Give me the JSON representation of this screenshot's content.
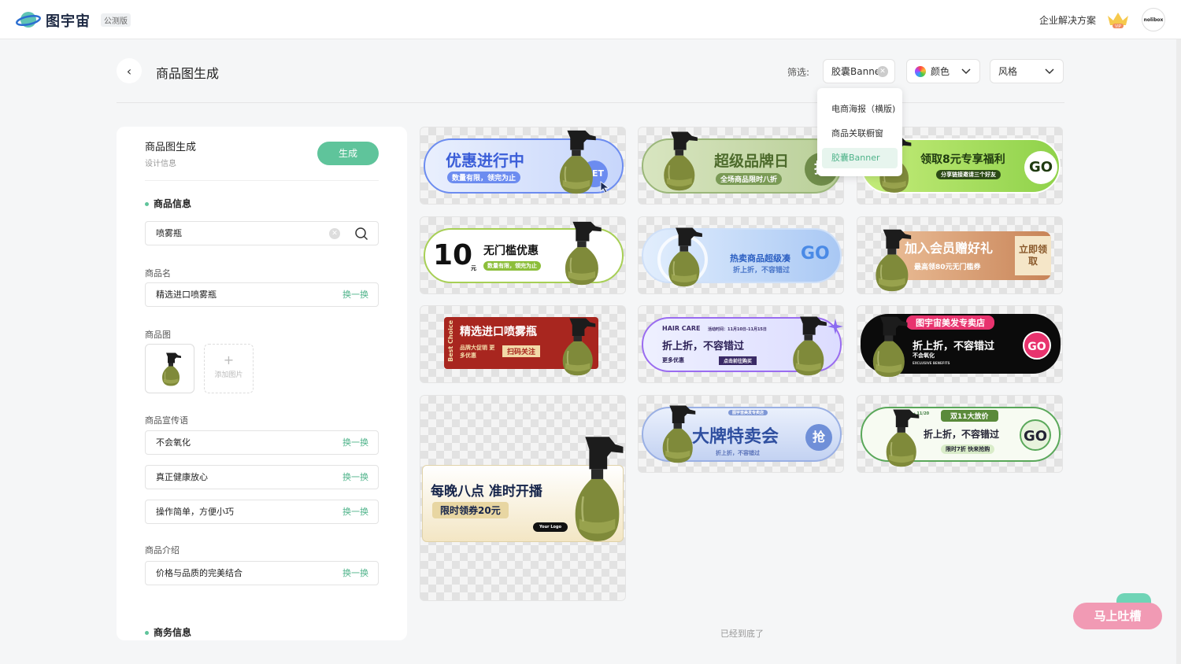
{
  "app": {
    "name": "图宇宙",
    "badge": "公测版",
    "enterprise_link": "企业解决方案",
    "vip_label": "VIP",
    "avatar_text": "nolibox"
  },
  "page": {
    "title": "商品图生成",
    "end_text": "已经到底了",
    "feedback": "马上吐槽"
  },
  "filters": {
    "label": "筛选:",
    "selected": "胶囊Banner",
    "color": "颜色",
    "style": "风格",
    "options": [
      "电商海报（横版)",
      "商品关联橱窗",
      "胶囊Banner"
    ]
  },
  "panel": {
    "title": "商品图生成",
    "subtitle": "设计信息",
    "generate": "生成",
    "sections": {
      "product_info": "商品信息",
      "business_info": "商务信息"
    },
    "search_value": "喷雾瓶",
    "swap_label": "换一换",
    "name_label": "商品名",
    "name_value": "精选进口喷雾瓶",
    "image_label": "商品图",
    "add_image": "添加图片",
    "slogan_label": "商品宣传语",
    "slogans": [
      "不会氧化",
      "真正健康放心",
      "操作简单，方便小巧"
    ],
    "intro_label": "商品介绍",
    "intro_value": "价格与品质的完美结合"
  },
  "colors": {
    "accent": "#5fc49b",
    "accent_text": "#4fb38a"
  },
  "cards": [
    {
      "main": "优惠进行中",
      "sub": "数量有限，领完为止",
      "cta": "GET"
    },
    {
      "main": "超级品牌日",
      "sub": "全场商品限时八折",
      "cta": "抢"
    },
    {
      "main": "领取8元专享福利",
      "sub": "分享链接邀请三个好友",
      "cta": "GO"
    },
    {
      "big": "10",
      "unit": "元",
      "main": "无门槛优惠",
      "sub": "数量有限，领完为止"
    },
    {
      "main": "热卖商品超级凑",
      "sub": "折上折，不容错过",
      "cta": "GO"
    },
    {
      "main": "加入会员赠好礼",
      "sub": "最高领80元无门槛券",
      "cta": "立即领取"
    },
    {
      "side": "Best Choice",
      "main": "精选进口喷雾瓶",
      "sub": "品牌大促销 更多优惠",
      "cta": "扫码关注"
    },
    {
      "top": "HAIR CARE",
      "main": "折上折，不容错过",
      "sub": "更多优惠",
      "cta": "点击前往购买",
      "date": "活动时间：11月10日-11月15日"
    },
    {
      "top": "图宇宙美发专卖店",
      "main": "折上折，不容错过",
      "sub": "不会氧化",
      "cta": "GO",
      "tag": "EXCLUSIVE BENEFITS"
    },
    {
      "main": "每晚八点 准时开播",
      "sub": "限时领券20元",
      "cta": "Your Logo"
    },
    {
      "top": "图宇宙美发专卖店",
      "main": "大牌特卖会",
      "sub": "折上折，不容错过",
      "cta": "抢"
    },
    {
      "date": "11/11 → 11/20",
      "top": "双11大放价",
      "main": "折上折，不容错过",
      "sub": "限时7折 快来抢购",
      "cta": "GO"
    }
  ]
}
